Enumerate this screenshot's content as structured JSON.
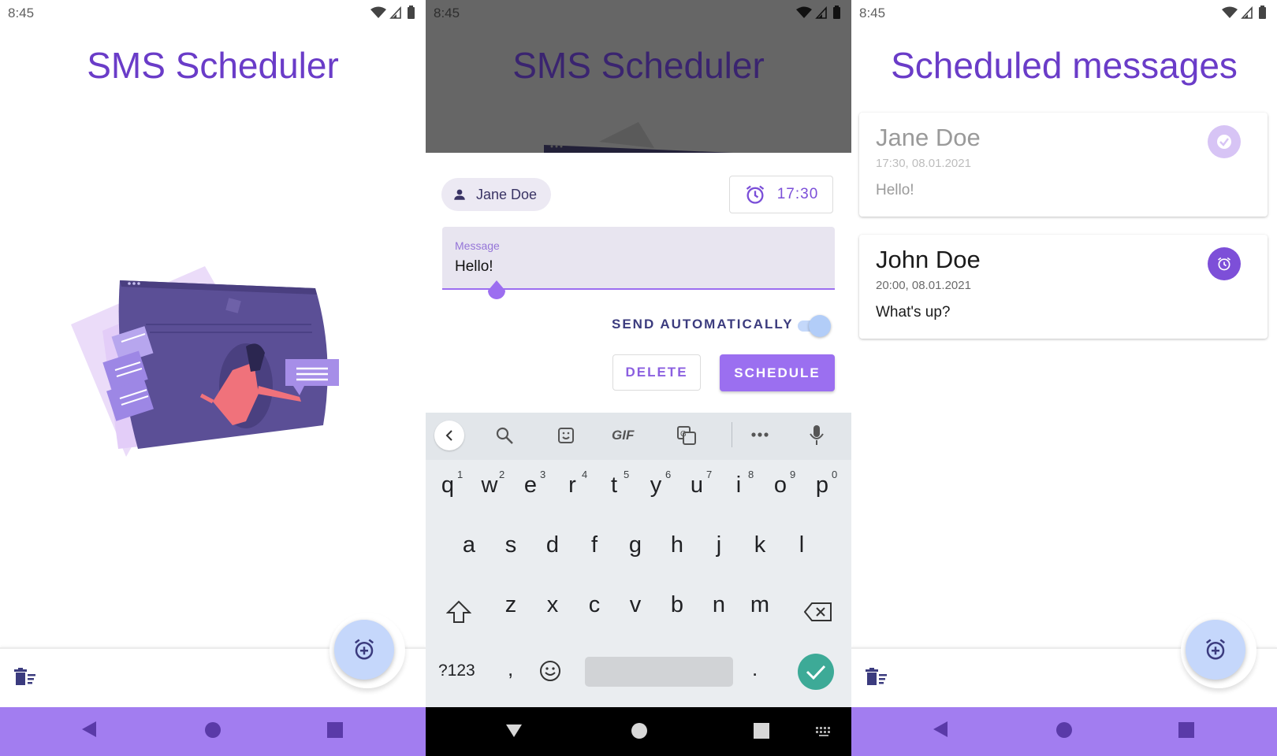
{
  "status_bar": {
    "time": "8:45"
  },
  "screen1": {
    "title": "SMS Scheduler",
    "bottom": {
      "delete_icon": "delete-sweep-icon",
      "fab_icon": "alarm-add-icon"
    },
    "nav": [
      "back-triangle-icon",
      "home-circle-icon",
      "recents-square-icon"
    ]
  },
  "screen2": {
    "title": "SMS Scheduler",
    "contact_chip": {
      "icon": "person-icon",
      "label": "Jane Doe"
    },
    "time_button": {
      "icon": "alarm-icon",
      "label": "17:30"
    },
    "message": {
      "label": "Message",
      "value": "Hello!"
    },
    "send_automatically": {
      "label": "SEND AUTOMATICALLY",
      "enabled": true
    },
    "delete_label": "DELETE",
    "schedule_label": "SCHEDULE",
    "keyboard": {
      "toolbar": [
        "back-chevron-icon",
        "search-icon",
        "sticker-icon",
        "GIF",
        "translate-icon",
        "more-icon",
        "mic-icon"
      ],
      "gif_label": "GIF",
      "row1": [
        "q",
        "w",
        "e",
        "r",
        "t",
        "y",
        "u",
        "i",
        "o",
        "p"
      ],
      "row1_hints": [
        "1",
        "2",
        "3",
        "4",
        "5",
        "6",
        "7",
        "8",
        "9",
        "0"
      ],
      "row2": [
        "a",
        "s",
        "d",
        "f",
        "g",
        "h",
        "j",
        "k",
        "l"
      ],
      "row3": [
        "z",
        "x",
        "c",
        "v",
        "b",
        "n",
        "m"
      ],
      "symbols_label": "?123",
      "comma": ",",
      "period": "."
    },
    "nav": [
      "back-down-triangle-icon",
      "home-circle-icon",
      "recents-square-icon",
      "keyboard-switch-icon"
    ]
  },
  "screen3": {
    "title": "Scheduled messages",
    "messages": [
      {
        "name": "Jane Doe",
        "datetime": "17:30, 08.01.2021",
        "text": "Hello!",
        "status": "sent",
        "status_icon": "check-circle-icon"
      },
      {
        "name": "John Doe",
        "datetime": "20:00, 08.01.2021",
        "text": "What's up?",
        "status": "scheduled",
        "status_icon": "alarm-icon"
      }
    ],
    "bottom": {
      "delete_icon": "delete-sweep-icon",
      "fab_icon": "alarm-add-icon"
    },
    "nav": [
      "back-triangle-icon",
      "home-circle-icon",
      "recents-square-icon"
    ]
  },
  "colors": {
    "accent": "#6a3cc8",
    "nav_purple": "#a27df0",
    "fab": "#c5d7fb",
    "button": "#9b6ff0"
  }
}
